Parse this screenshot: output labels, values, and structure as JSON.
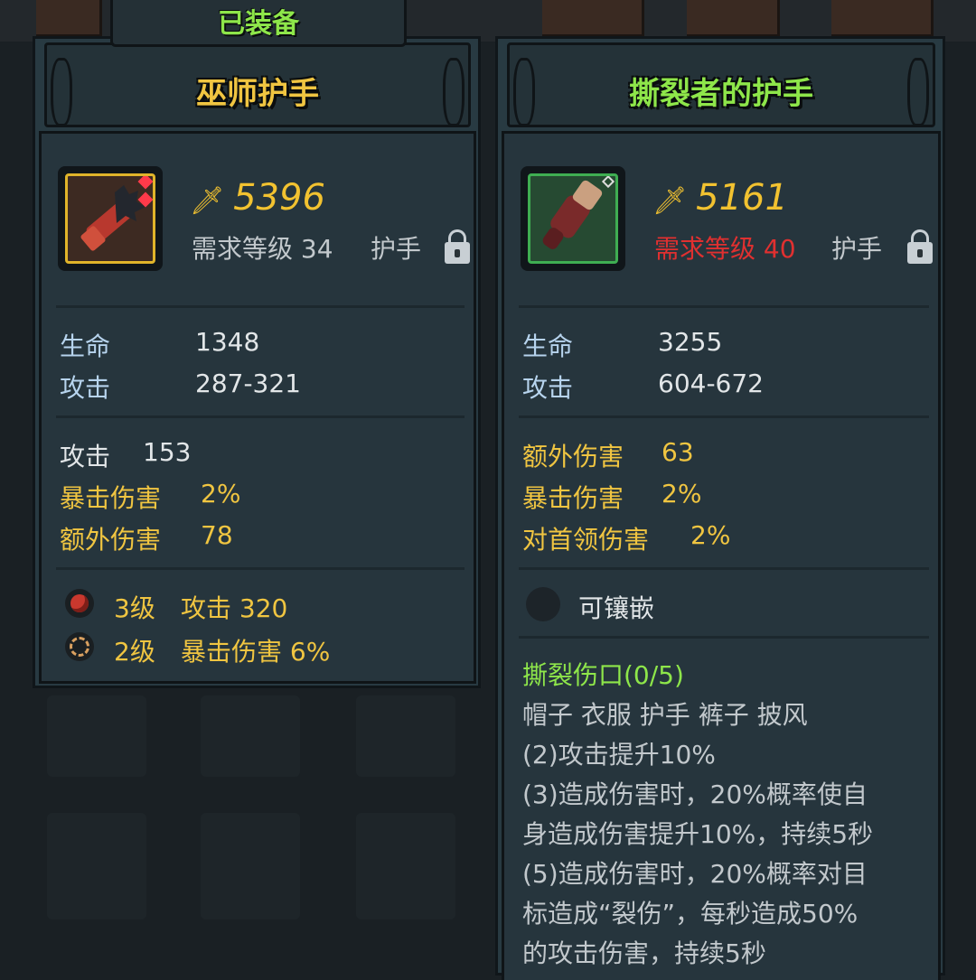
{
  "tab": {
    "label": "已装备"
  },
  "left_item": {
    "name": "巫师护手",
    "power": "5396",
    "required_level": "需求等级 34",
    "slot": "护手",
    "base_stats": [
      {
        "label": "生命",
        "value": "1348"
      },
      {
        "label": "攻击",
        "value": "287-321"
      }
    ],
    "extra_stats": [
      {
        "label": "攻击",
        "value": "153"
      },
      {
        "label": "暴击伤害",
        "value": "2%"
      },
      {
        "label": "额外伤害",
        "value": "78"
      }
    ],
    "gems": [
      {
        "level": "3级",
        "effect": "攻击 320",
        "icon": "red-gem-icon"
      },
      {
        "level": "2级",
        "effect": "暴击伤害 6%",
        "icon": "amber-ring-gem-icon"
      }
    ]
  },
  "right_item": {
    "name": "撕裂者的护手",
    "power": "5161",
    "required_level": "需求等级 40",
    "slot": "护手",
    "base_stats": [
      {
        "label": "生命",
        "value": "3255"
      },
      {
        "label": "攻击",
        "value": "604-672"
      }
    ],
    "extra_stats": [
      {
        "label": "额外伤害",
        "value": "63"
      },
      {
        "label": "暴击伤害",
        "value": "2%"
      },
      {
        "label": "对首领伤害",
        "value": "2%"
      }
    ],
    "socket": "可镶嵌",
    "set_name": "撕裂伤口(0/5)",
    "set_pieces": "帽子 衣服 护手 裤子 披风",
    "set_bonus": [
      "(2)攻击提升10%",
      "(3)造成伤害时，20%概率使自",
      "身造成伤害提升10%，持续5秒",
      "(5)造成伤害时，20%概率对目",
      "标造成“裂伤”，每秒造成50%",
      "的攻击伤害，持续5秒"
    ]
  },
  "colors": {
    "gold": "#f0c541",
    "green": "#8ee64a",
    "red": "#e03030",
    "label_blue": "#b7d4ee"
  }
}
